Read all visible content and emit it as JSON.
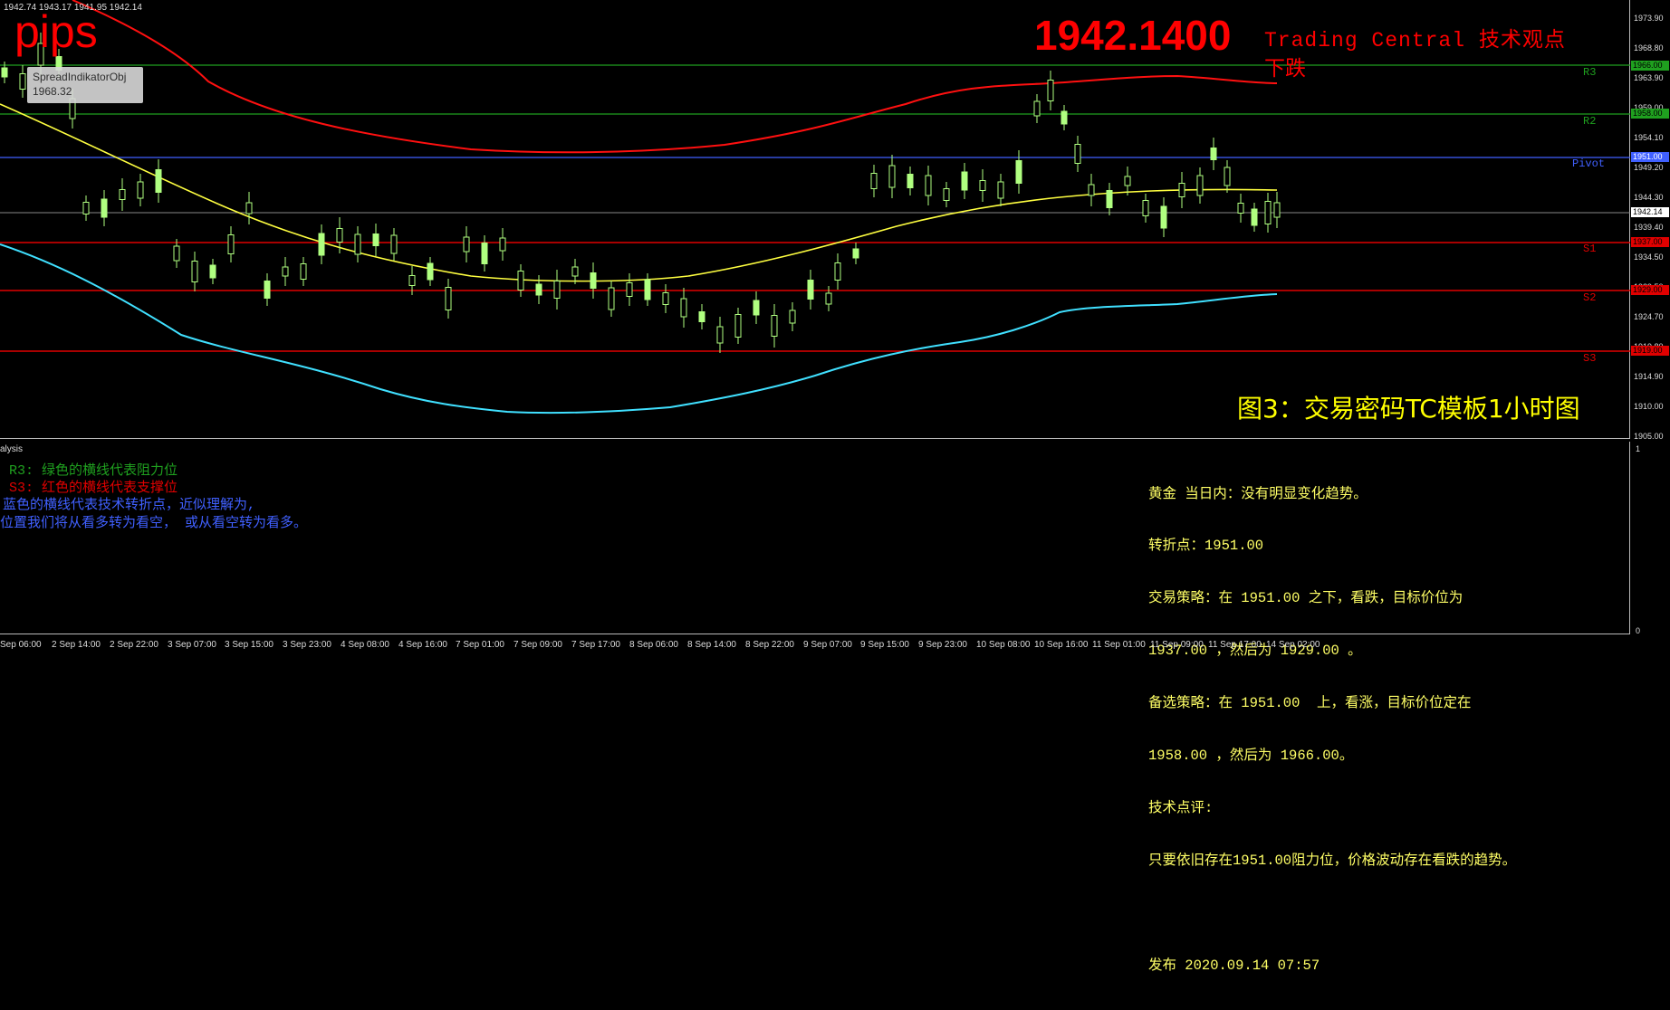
{
  "header": {
    "ohlc": "1942.74 1943.17 1941.95 1942.14",
    "pips_label": "pips",
    "tooltip_title": "SpreadIndikatorObj",
    "tooltip_value": "1968.32",
    "current_price": "1942.1400",
    "tc_title": "Trading Central 技术观点",
    "tc_view": "下跌",
    "caption": "图3：交易密码TC模板1小时图"
  },
  "price_axis": {
    "ticks": [
      "1973.90",
      "1968.80",
      "1963.90",
      "1959.00",
      "1954.10",
      "1949.20",
      "1944.30",
      "1939.40",
      "1934.50",
      "1929.50",
      "1924.70",
      "1919.80",
      "1914.90",
      "1910.00",
      "1905.00"
    ],
    "tag_r3": "1966.00",
    "tag_r2": "1958.00",
    "tag_pivot": "1951.00",
    "tag_price": "1942.14",
    "tag_s1": "1937.00",
    "tag_s2": "1929.00",
    "tag_s3": "1919.00"
  },
  "levels": {
    "r3": "R3",
    "r2": "R2",
    "pivot": "Pivot",
    "s1": "S1",
    "s2": "S2",
    "s3": "S3"
  },
  "colors": {
    "resistance": "#1fa01f",
    "support": "#e00000",
    "pivot": "#4060ff",
    "ma_yellow": "#ffff40",
    "band_red": "#ff1010",
    "band_cyan": "#40e0ff",
    "candle": "#b0ff80"
  },
  "panel": {
    "title": "alysis",
    "legend": [
      "R3: 绿色的横线代表阻力位",
      "S3: 红色的横线代表支撑位",
      "蓝色的横线代表技术转折点，近似理解为,",
      "位置我们将从看多转为看空， 或从看空转为看多。"
    ],
    "analysis_lines": [
      "黄金 当日内：没有明显变化趋势。",
      "转折点：1951.00",
      "交易策略：在 1951.00 之下，看跌，目标价位为",
      "1937.00 ，然后为 1929.00 。",
      "备选策略：在 1951.00  上，看涨，目标价位定在",
      "1958.00 ，然后为 1966.00。",
      "技术点评:",
      "只要依旧存在1951.00阻力位，价格波动存在看跌的趋势。",
      "",
      "发布 2020.09.14 07:57"
    ],
    "scale_top": "1",
    "scale_bottom": "0"
  },
  "time_axis": {
    "labels": [
      "Sep 06:00",
      "2 Sep 14:00",
      "2 Sep 22:00",
      "3 Sep 07:00",
      "3 Sep 15:00",
      "3 Sep 23:00",
      "4 Sep 08:00",
      "4 Sep 16:00",
      "7 Sep 01:00",
      "7 Sep 09:00",
      "7 Sep 17:00",
      "8 Sep 06:00",
      "8 Sep 14:00",
      "8 Sep 22:00",
      "9 Sep 07:00",
      "9 Sep 15:00",
      "9 Sep 23:00",
      "10 Sep 08:00",
      "10 Sep 16:00",
      "11 Sep 01:00",
      "11 Sep 09:00",
      "11 Sep 17:00",
      "14 Sep 02:00"
    ]
  }
}
